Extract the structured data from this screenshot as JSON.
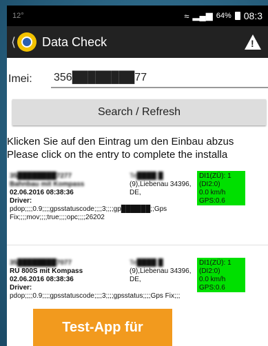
{
  "status": {
    "left": "12°",
    "battery": "64%",
    "time": "08:3"
  },
  "app": {
    "title": "Data Check"
  },
  "imei": {
    "label": "Imei:",
    "value": "356████████77"
  },
  "search_button": "Search / Refresh",
  "hint": {
    "de": "Klicken Sie auf den Eintrag um den Einbau abzus",
    "en": "Please click on the entry to complete the installa"
  },
  "entries": [
    {
      "id": "35████████7277",
      "name": "Bahnbau mit Kompass",
      "datetime": "02.06.2016 08:38:36",
      "driver": "Driver:",
      "addr1": "Te████ █",
      "addr2": "(9),Liebenau 34396,",
      "addr3": "DE,",
      "status": [
        "DI1(ZÜ): 1",
        "(DI2:0)",
        "0.0 km/h",
        "GPS:0.6"
      ],
      "details": "pdop;;;;0.9;;;;gpsstatuscode;;;;3;;;;gp██████;;Gps Fix;;;;mov;;;;true;;;;opc;;;;26202"
    },
    {
      "id": "35████████7077",
      "name": "RU 800S mit Kompass",
      "datetime": "02.06.2016 08:38:36",
      "driver": "Driver:",
      "addr1": "Te████ █",
      "addr2": "(9),Liebenau 34396,",
      "addr3": "DE,",
      "status": [
        "DI1(ZÜ): 1",
        "(DI2:0)",
        "0.0 km/h",
        "GPS:0.6"
      ],
      "details": "pdop;;;;0.9;;;;gpsstatuscode;;;;3;;;;gpsstatus;;;;Gps Fix;;;"
    }
  ],
  "overlay": "Test-App für"
}
